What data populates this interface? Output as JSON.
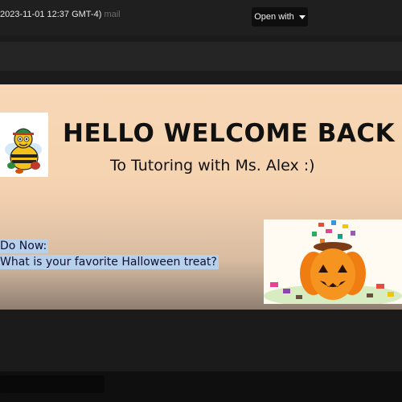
{
  "viewer": {
    "file_title": "2023-11-01 12:37 GMT-4)",
    "file_title_ghost": "mail",
    "open_with_label": "Open with"
  },
  "slide": {
    "title": "HELLO WELCOME BACK !!",
    "subtitle": "To Tutoring with Ms. Alex :)",
    "do_now_label": "Do Now:",
    "do_now_question": "What is your favorite Halloween treat?"
  },
  "colors": {
    "slide_background": "#f5d3b1",
    "highlight": "#b7d0ec",
    "pumpkin": "#f08a1c",
    "viewer_background": "#1b1b1b"
  },
  "icons": {
    "open_with": "chevron-down-icon",
    "clipart_left": "bee-mascot-icon",
    "clipart_right": "pumpkin-candy-icon"
  }
}
